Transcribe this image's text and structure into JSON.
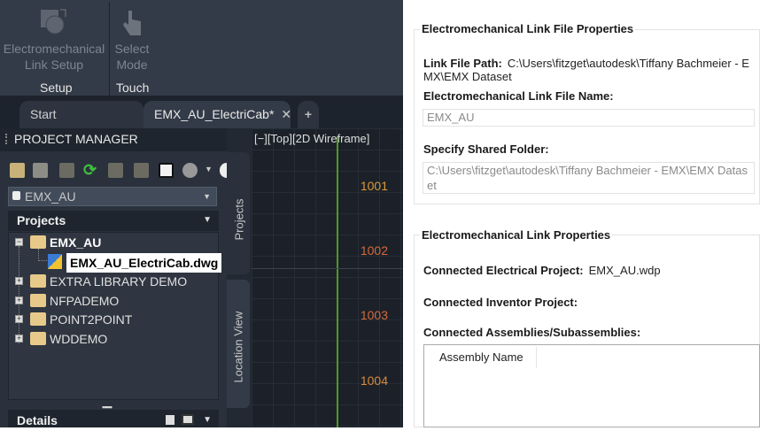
{
  "ribbon": {
    "buttons": [
      {
        "label_line1": "Electromechanical",
        "label_line2": "Link Setup",
        "icon": "link-setup-icon"
      },
      {
        "label_line1": "Select",
        "label_line2": "Mode",
        "icon": "touch-hand-icon"
      }
    ],
    "groups": [
      "Setup",
      "Touch"
    ]
  },
  "tabs": {
    "items": [
      "Start",
      "EMX_AU_ElectriCab*"
    ],
    "close": "✕",
    "add": "+"
  },
  "project_manager": {
    "title": "PROJECT MANAGER",
    "current_project": "EMX_AU",
    "projects_header": "Projects",
    "tree": [
      {
        "label": "EMX_AU",
        "expanded": true,
        "active": true,
        "children": [
          {
            "label": "EMX_AU_ElectriCab.dwg",
            "selected": true
          }
        ]
      },
      {
        "label": "EXTRA LIBRARY DEMO"
      },
      {
        "label": "NFPADEMO"
      },
      {
        "label": "POINT2POINT"
      },
      {
        "label": "WDDEMO"
      }
    ],
    "details_header": "Details",
    "vertical_tabs": [
      "Projects",
      "Location View"
    ]
  },
  "viewport": {
    "label": "[−][Top][2D Wireframe]",
    "line_refs": [
      "1001",
      "1002",
      "1003",
      "1004"
    ]
  },
  "link_file": {
    "title": "Electromechanical Link File Properties",
    "path_label": "Link File Path:",
    "path_value": "C:\\Users\\fitzget\\autodesk\\Tiffany Bachmeier - EMX\\EMX Dataset",
    "name_label": "Electromechanical Link File Name:",
    "name_value": "EMX_AU",
    "folder_label": "Specify Shared Folder:",
    "folder_value": "C:\\Users\\fitzget\\autodesk\\Tiffany Bachmeier - EMX\\EMX Dataset"
  },
  "link_props": {
    "title": "Electromechanical Link Properties",
    "elec_label": "Connected Electrical Project:",
    "elec_value": "EMX_AU.wdp",
    "inv_label": "Connected Inventor Project:",
    "asm_label": "Connected Assemblies/Subassemblies:",
    "columns": [
      "Assembly Name"
    ]
  }
}
